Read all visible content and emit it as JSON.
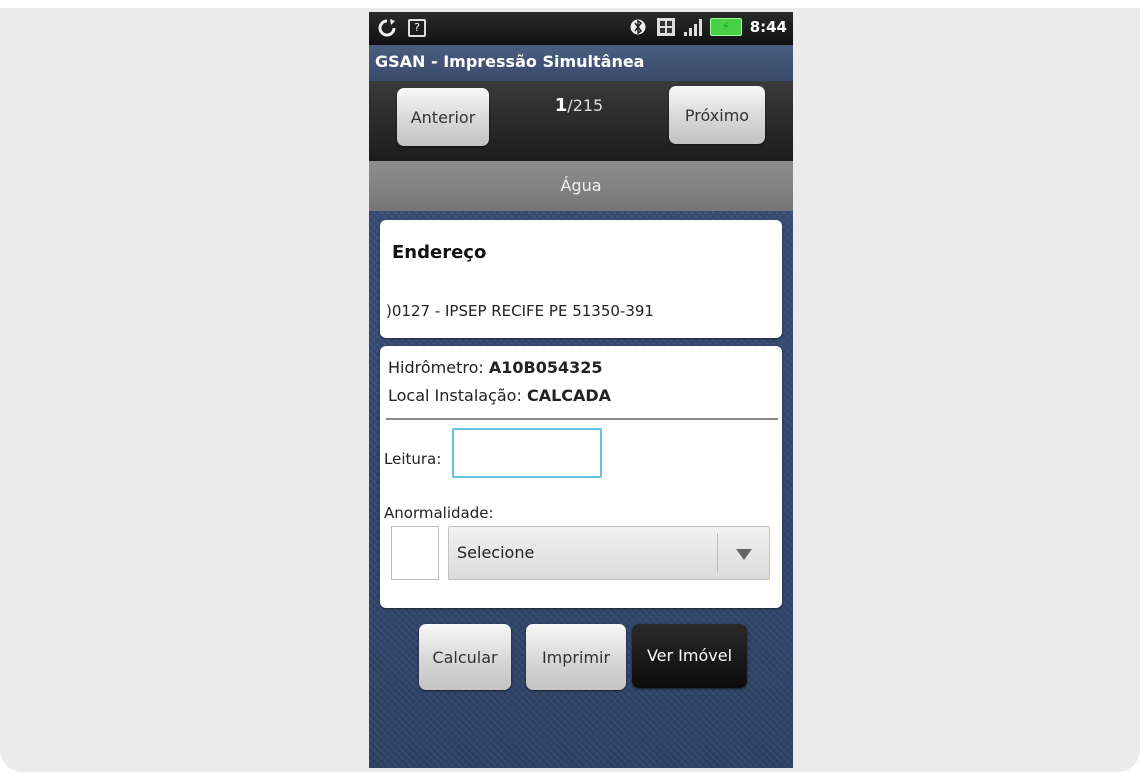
{
  "status_bar": {
    "clock": "8:44",
    "icons": [
      "sync-icon",
      "sim-card-icon",
      "bluetooth-icon",
      "storage-icon",
      "signal-icon",
      "battery-charging-icon"
    ]
  },
  "app": {
    "title": "GSAN - Impressão Simultânea"
  },
  "nav": {
    "prev_label": "Anterior",
    "next_label": "Próximo",
    "current": "1",
    "total": "/215"
  },
  "section": {
    "title": "Água"
  },
  "address": {
    "title": "Endereço",
    "line": ")0127 - IPSEP RECIFE PE 51350-391"
  },
  "meter": {
    "label": "Hidrômetro: ",
    "value": "A10B054325",
    "location_label": "Local Instalação: ",
    "location_value": "CALCADA"
  },
  "reading": {
    "label": "Leitura:",
    "value": ""
  },
  "anomaly": {
    "label": "Anormalidade:",
    "code": "",
    "selected": "Selecione"
  },
  "actions": {
    "calculate_label": "Calcular",
    "print_label": "Imprimir",
    "view_label": "Ver Imóvel"
  },
  "colors": {
    "input_focus": "#62c4dc",
    "background": "#33476b"
  }
}
